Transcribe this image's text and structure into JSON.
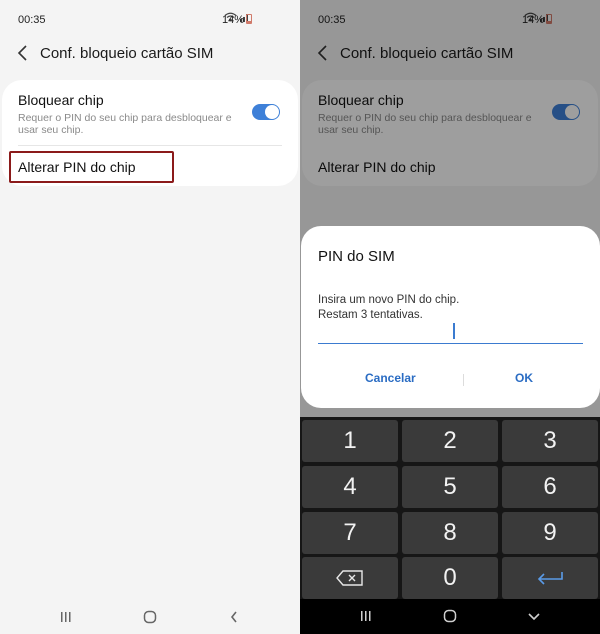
{
  "left": {
    "status": {
      "time": "00:35",
      "battery": "14%"
    },
    "header": {
      "title": "Conf. bloqueio cartão SIM"
    },
    "lock_sim": {
      "title": "Bloquear chip",
      "subtitle": "Requer o PIN do seu chip para desbloquear e usar seu chip.",
      "enabled": true
    },
    "change_pin": {
      "label": "Alterar PIN do chip"
    }
  },
  "right": {
    "status": {
      "time": "00:35",
      "battery": "14%"
    },
    "header": {
      "title": "Conf. bloqueio cartão SIM"
    },
    "lock_sim": {
      "title": "Bloquear chip",
      "subtitle": "Requer o PIN do seu chip para desbloquear e usar seu chip.",
      "enabled": true
    },
    "change_pin": {
      "label": "Alterar PIN do chip"
    },
    "dialog": {
      "title": "PIN do SIM",
      "message_line1": "Insira um novo PIN do chip.",
      "message_line2": "Restam 3 tentativas.",
      "cancel_label": "Cancelar",
      "ok_label": "OK"
    },
    "keypad": {
      "keys": [
        "1",
        "2",
        "3",
        "4",
        "5",
        "6",
        "7",
        "8",
        "9",
        "0"
      ]
    }
  },
  "colors": {
    "accent": "#3e80d8",
    "dialog_button": "#2a6cc3",
    "highlight_border": "#8b1a1a"
  },
  "icons": {
    "wifi": "wifi-icon",
    "signal": "signal-icon",
    "back": "back-arrow-icon",
    "backspace": "backspace-icon",
    "enter": "enter-icon"
  }
}
